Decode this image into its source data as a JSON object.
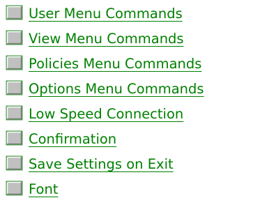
{
  "colors": {
    "link": "#008000",
    "icon_face": "#c0c0c0",
    "icon_border": "#4a9a4a"
  },
  "icon": "gray-square-button-icon",
  "links": [
    {
      "label": "User Menu Commands"
    },
    {
      "label": "View Menu Commands"
    },
    {
      "label": "Policies Menu Commands"
    },
    {
      "label": "Options Menu Commands"
    },
    {
      "label": "Low Speed Connection"
    },
    {
      "label": "Confirmation"
    },
    {
      "label": "Save Settings on Exit"
    },
    {
      "label": "Font"
    }
  ]
}
